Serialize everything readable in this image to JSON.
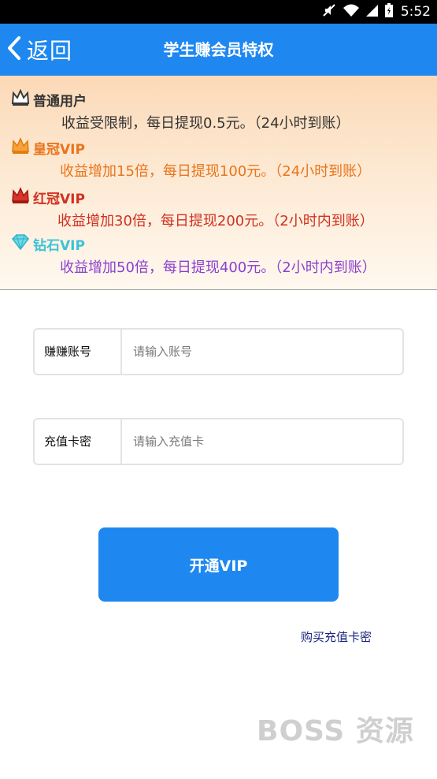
{
  "status_bar": {
    "time": "5:52",
    "icons": [
      "mute-icon",
      "wifi-icon",
      "signal-icon",
      "battery-icon"
    ]
  },
  "nav": {
    "back_label": "返回",
    "title": "学生赚会员特权",
    "color": "#1e88f0"
  },
  "tiers": [
    {
      "name": "普通用户",
      "desc": "收益受限制，每日提现0.5元。（24小时到账）",
      "color": "#333333",
      "icon": "crown-gray-icon"
    },
    {
      "name": "皇冠VIP",
      "desc": "收益增加15倍，每日提现100元。（24小时到账）",
      "color": "#e8741c",
      "icon": "crown-orange-icon"
    },
    {
      "name": "红冠VIP",
      "desc": "收益增加30倍，每日提现200元。（2小时内到账）",
      "color": "#d03020",
      "icon": "crown-red-icon"
    },
    {
      "name": "钻石VIP",
      "desc": "收益增加50倍，每日提现400元。（2小时内到账）",
      "color": "#8a3fd0",
      "name_color": "#3cc3d6",
      "icon": "diamond-icon"
    }
  ],
  "form": {
    "account_label": "赚赚账号",
    "account_placeholder": "请输入账号",
    "card_label": "充值卡密",
    "card_placeholder": "请输入充值卡"
  },
  "submit_label": "开通VIP",
  "buy_link": "购买充值卡密",
  "watermark": "BOSS 资源"
}
